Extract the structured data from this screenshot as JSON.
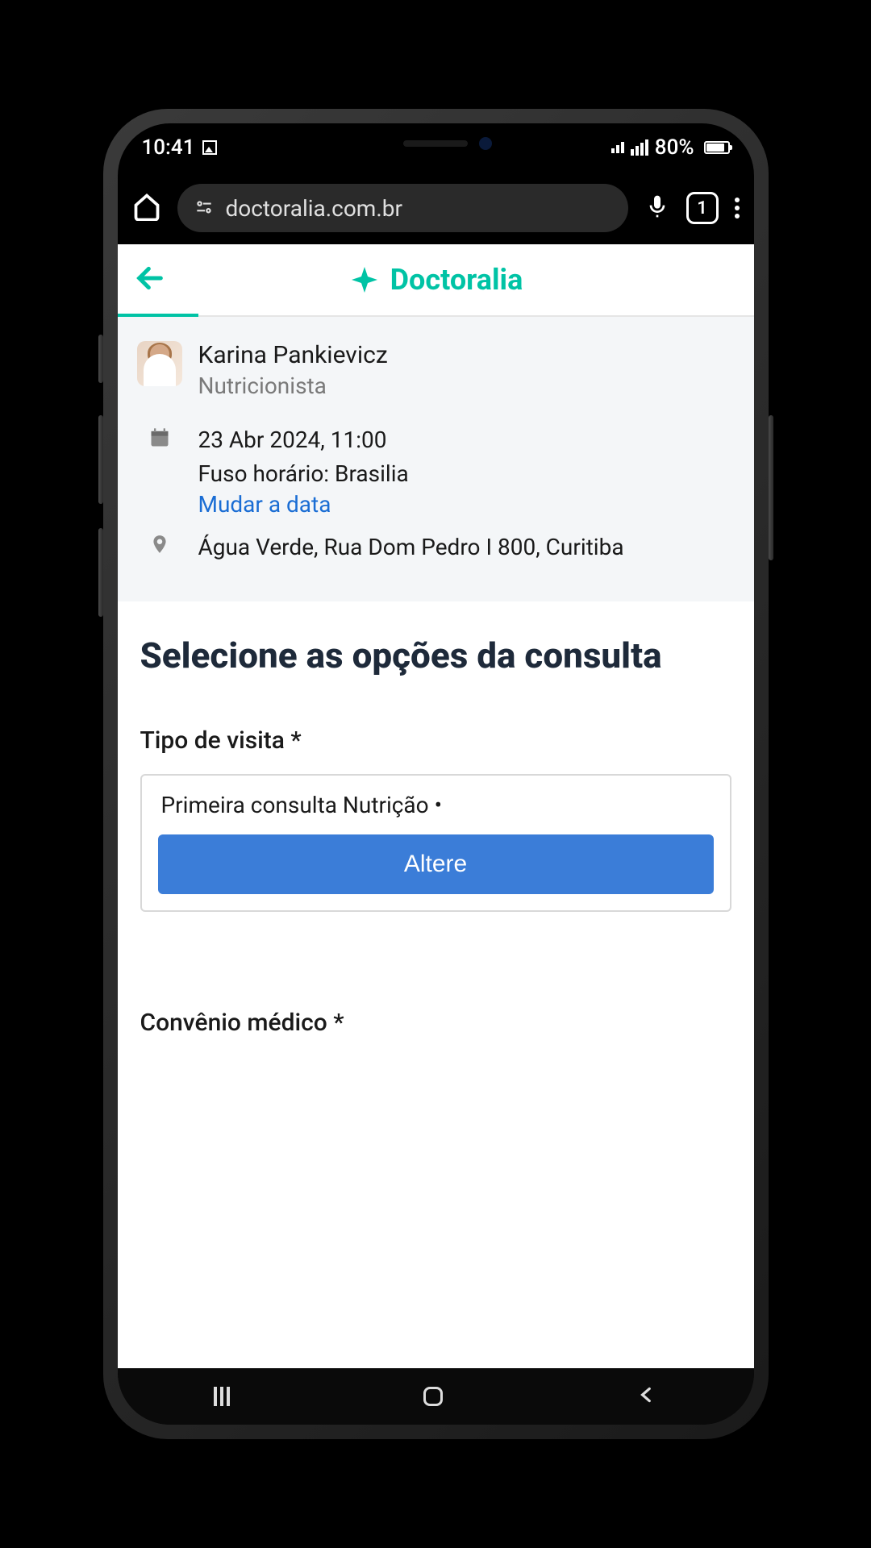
{
  "status_bar": {
    "time": "10:41",
    "battery_percent": "80%"
  },
  "browser": {
    "url": "doctoralia.com.br",
    "tab_count": "1"
  },
  "app": {
    "brand": "Doctoralia"
  },
  "doctor": {
    "name": "Karina Pankievicz",
    "specialty": "Nutricionista"
  },
  "appointment": {
    "datetime": "23 Abr 2024, 11:00",
    "timezone": "Fuso horário: Brasilia",
    "change_date_link": "Mudar a data",
    "address": "Água Verde, Rua Dom Pedro I 800, Curitiba"
  },
  "form": {
    "section_title": "Selecione as opções da consulta",
    "visit_type_label": "Tipo de visita *",
    "visit_type_value": "Primeira consulta Nutrição •",
    "change_button": "Altere",
    "insurance_label": "Convênio médico *"
  }
}
